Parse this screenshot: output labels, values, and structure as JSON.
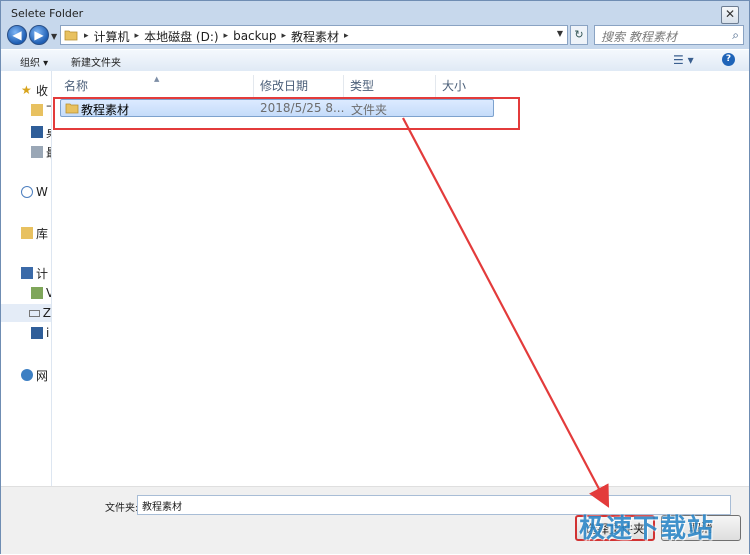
{
  "window": {
    "title": "Selete Folder",
    "close_glyph": "✕"
  },
  "navigation": {
    "back_glyph": "◀",
    "forward_glyph": "▶",
    "crumbs": [
      "计算机",
      "本地磁盘 (D:)",
      "backup",
      "教程素材"
    ],
    "separator": "▸",
    "search_placeholder": "搜索 教程素材",
    "refresh_glyph": "↻"
  },
  "toolbar": {
    "organize_label": "组织 ▾",
    "new_folder_label": "新建文件夹",
    "view_glyph": "☰ ▾",
    "help_glyph": "?"
  },
  "sidebar": {
    "items": [
      {
        "label": "收",
        "icon": "star-icon"
      },
      {
        "label": "下",
        "icon": "download-folder-icon"
      },
      {
        "label": "桌",
        "icon": "desktop-icon"
      },
      {
        "label": "最",
        "icon": "recent-places-icon"
      },
      {
        "label": "W",
        "icon": "cloud-icon"
      },
      {
        "label": "库",
        "icon": "library-icon"
      },
      {
        "label": "计",
        "icon": "computer-icon"
      },
      {
        "label": "V",
        "icon": "drive-c-icon"
      },
      {
        "label": "Z",
        "icon": "drive-d-icon"
      },
      {
        "label": "i",
        "icon": "drive-icon"
      },
      {
        "label": "网",
        "icon": "network-icon"
      }
    ]
  },
  "columns": [
    "名称",
    "修改日期",
    "类型",
    "大小"
  ],
  "files": [
    {
      "name": "教程素材",
      "modified": "2018/5/25 8...",
      "type": "文件夹",
      "size": ""
    }
  ],
  "bottom": {
    "folder_label": "文件夹:",
    "folder_value": "教程素材",
    "select_button": "选择文件夹",
    "cancel_button": "取消"
  },
  "watermark": "极速下载站",
  "colors": {
    "highlight": "#e33b3b",
    "watermark": "#2e88c8",
    "selection": "#c5dcfa"
  }
}
